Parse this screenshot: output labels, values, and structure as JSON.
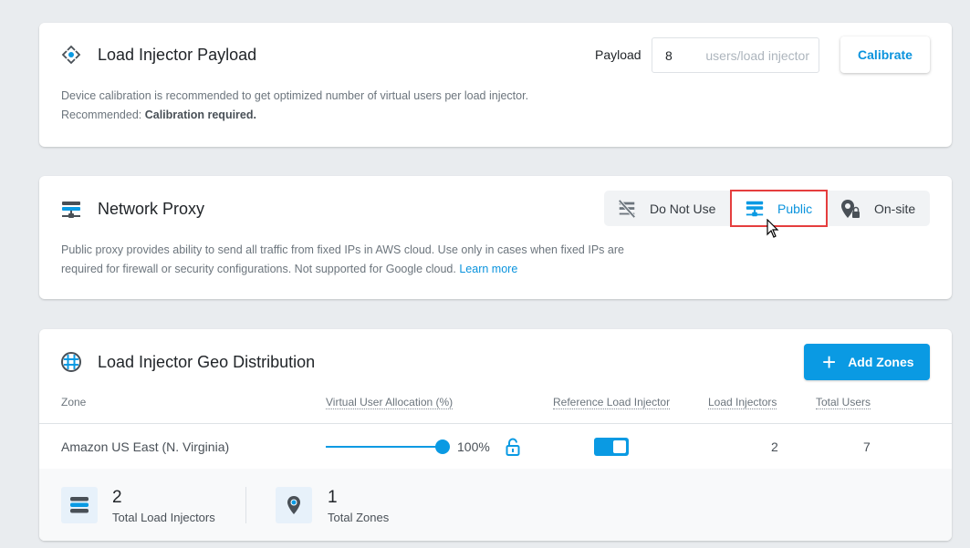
{
  "payload_card": {
    "title": "Load Injector Payload",
    "icon": "move-arrows-icon",
    "payload_label": "Payload",
    "payload_value": "8",
    "payload_unit": "users/load injector",
    "calibrate_label": "Calibrate",
    "description_line1": "Device calibration is recommended to get optimized number of virtual users per load injector.",
    "recommended_label": "Recommended:",
    "recommended_value": "Calibration required."
  },
  "proxy_card": {
    "title": "Network Proxy",
    "icon": "server-network-icon",
    "options": [
      {
        "label": "Do Not Use",
        "icon": "server-off-icon",
        "selected": false
      },
      {
        "label": "Public",
        "icon": "server-network-icon",
        "selected": true
      },
      {
        "label": "On-site",
        "icon": "location-lock-icon",
        "selected": false
      }
    ],
    "description_line1": "Public proxy provides ability to send all traffic from fixed IPs in AWS cloud. Use only in cases when fixed IPs are",
    "description_line2": "required for firewall or security configurations. Not supported for Google cloud.",
    "learn_more": "Learn more"
  },
  "geo_card": {
    "title": "Load Injector Geo Distribution",
    "icon": "globe-icon",
    "add_zones_label": "Add Zones",
    "columns": [
      "Zone",
      "Virtual User Allocation (%)",
      "Reference Load Injector",
      "Load Injectors",
      "Total Users"
    ],
    "rows": [
      {
        "zone": "Amazon US East (N. Virginia)",
        "allocation_percent": 100,
        "allocation_label": "100%",
        "reference": true,
        "load_injectors": "2",
        "total_users": "7"
      }
    ],
    "summary": {
      "total_load_injectors": "2",
      "total_load_injectors_label": "Total Load Injectors",
      "total_zones": "1",
      "total_zones_label": "Total Zones"
    }
  },
  "colors": {
    "accent": "#0a9ae3",
    "highlight_border": "#e53e3e",
    "background": "#e9ecef"
  }
}
